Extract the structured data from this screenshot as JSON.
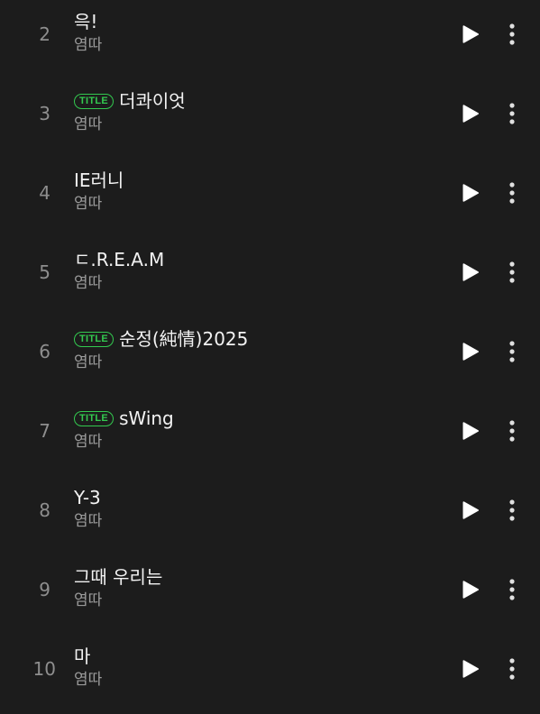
{
  "icons": {
    "play": "play-icon",
    "more": "more-vertical-icon"
  },
  "colors": {
    "background": "#1c1c1c",
    "title_badge": "#33c94f",
    "track_number": "#8e8e8e",
    "artist": "#9a9a9a"
  },
  "tracks": [
    {
      "number": "2",
      "title": "윽!",
      "artist": "염따",
      "badge": ""
    },
    {
      "number": "3",
      "title": "더콰이엇",
      "artist": "염따",
      "badge": "TITLE"
    },
    {
      "number": "4",
      "title": "IE러니",
      "artist": "염따",
      "badge": ""
    },
    {
      "number": "5",
      "title": "ㄷ.R.E.A.M",
      "artist": "염따",
      "badge": ""
    },
    {
      "number": "6",
      "title": "순정(純情)2025",
      "artist": "염따",
      "badge": "TITLE"
    },
    {
      "number": "7",
      "title": "sWing",
      "artist": "염따",
      "badge": "TITLE"
    },
    {
      "number": "8",
      "title": "Y-3",
      "artist": "염따",
      "badge": ""
    },
    {
      "number": "9",
      "title": "그때 우리는",
      "artist": "염따",
      "badge": ""
    },
    {
      "number": "10",
      "title": "마",
      "artist": "염따",
      "badge": ""
    }
  ]
}
